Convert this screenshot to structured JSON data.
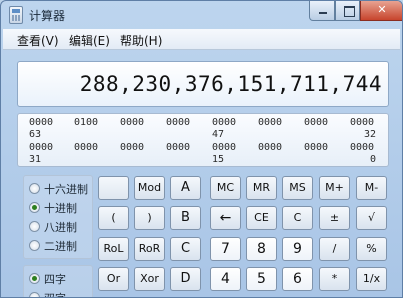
{
  "window": {
    "title": "计算器"
  },
  "menu": {
    "view": "查看(V)",
    "edit": "编辑(E)",
    "help": "帮助(H)"
  },
  "display": {
    "value": "288,230,376,151,711,744"
  },
  "binary": {
    "row1": [
      "0000",
      "0100",
      "0000",
      "0000",
      "0000",
      "0000",
      "0000",
      "0000"
    ],
    "row1_positions": {
      "left": "63",
      "mid": "47",
      "right": "32"
    },
    "row2": [
      "0000",
      "0000",
      "0000",
      "0000",
      "0000",
      "0000",
      "0000",
      "0000"
    ],
    "row2_positions": {
      "left": "31",
      "mid": "15",
      "right": "0"
    }
  },
  "radix": [
    {
      "label": "十六进制",
      "selected": false
    },
    {
      "label": "十进制",
      "selected": true
    },
    {
      "label": "八进制",
      "selected": false
    },
    {
      "label": "二进制",
      "selected": false
    }
  ],
  "word_size": [
    {
      "label": "四字",
      "selected": true
    },
    {
      "label": "双字",
      "selected": false
    }
  ],
  "keys": [
    [
      "",
      "Mod",
      "A",
      "MC",
      "MR",
      "MS",
      "M+",
      "M-"
    ],
    [
      "(",
      ")",
      "B",
      "←",
      "CE",
      "C",
      "±",
      "√"
    ],
    [
      "RoL",
      "RoR",
      "C",
      "7",
      "8",
      "9",
      "/",
      "%"
    ],
    [
      "Or",
      "Xor",
      "D",
      "4",
      "5",
      "6",
      "*",
      "1/x"
    ]
  ]
}
